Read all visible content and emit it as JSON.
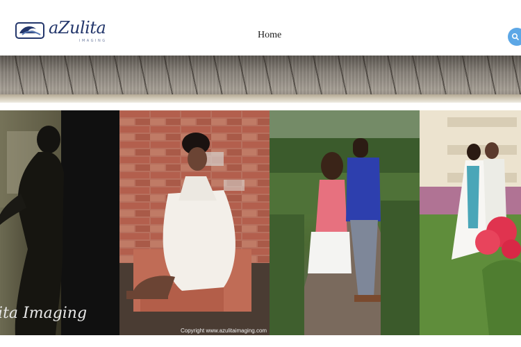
{
  "header": {
    "logo_text": "aZulita",
    "logo_subtext": "IMAGING",
    "nav": [
      {
        "label": "Home"
      }
    ]
  },
  "gallery": {
    "watermark": "lita Imaging",
    "copyright": "Copyright www.azulitaimaging.com"
  },
  "colors": {
    "logo_blue": "#23366b",
    "search_button": "#5ca7e6"
  },
  "icons": {
    "logo_mark": "logo-wave-icon",
    "search": "search-icon"
  }
}
